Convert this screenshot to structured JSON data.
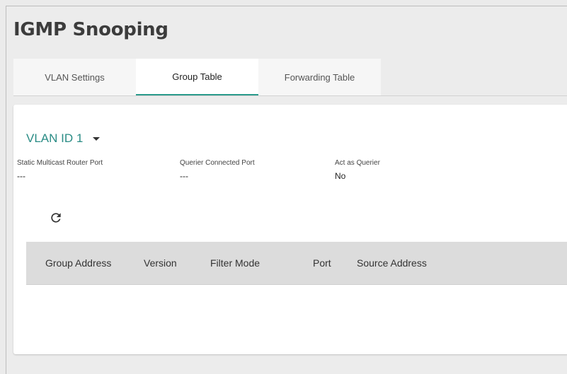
{
  "page": {
    "title": "IGMP Snooping"
  },
  "tabs": [
    {
      "label": "VLAN Settings"
    },
    {
      "label": "Group Table",
      "active": true
    },
    {
      "label": "Forwarding Table"
    }
  ],
  "vlan": {
    "selected": "VLAN ID 1"
  },
  "info": {
    "static_multicast_router_port": {
      "label": "Static Multicast Router Port",
      "value": "---"
    },
    "querier_connected_port": {
      "label": "Querier Connected Port",
      "value": "---"
    },
    "act_as_querier": {
      "label": "Act as Querier",
      "value": "No"
    }
  },
  "toolbar": {
    "refresh_icon": "refresh-icon"
  },
  "table": {
    "columns": [
      "Group Address",
      "Version",
      "Filter Mode",
      "Port",
      "Source Address"
    ],
    "rows": []
  },
  "colors": {
    "accent": "#2a9a8c",
    "header_bg": "#dcdcdc"
  }
}
